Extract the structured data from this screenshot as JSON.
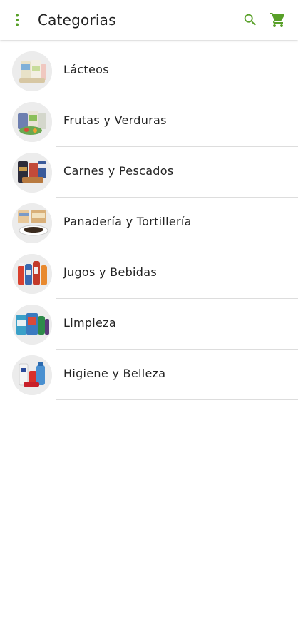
{
  "app_bar": {
    "title": "Categorias",
    "menu_icon": "more-vert-icon",
    "search_icon": "search-icon",
    "cart_icon": "shopping-cart-icon",
    "accent_color": "#58a028"
  },
  "categories": [
    {
      "label": "Lácteos"
    },
    {
      "label": "Frutas y Verduras"
    },
    {
      "label": "Carnes y Pescados"
    },
    {
      "label": "Panadería y Tortillería"
    },
    {
      "label": "Jugos y Bebidas"
    },
    {
      "label": "Limpieza"
    },
    {
      "label": "Higiene y Belleza"
    }
  ]
}
